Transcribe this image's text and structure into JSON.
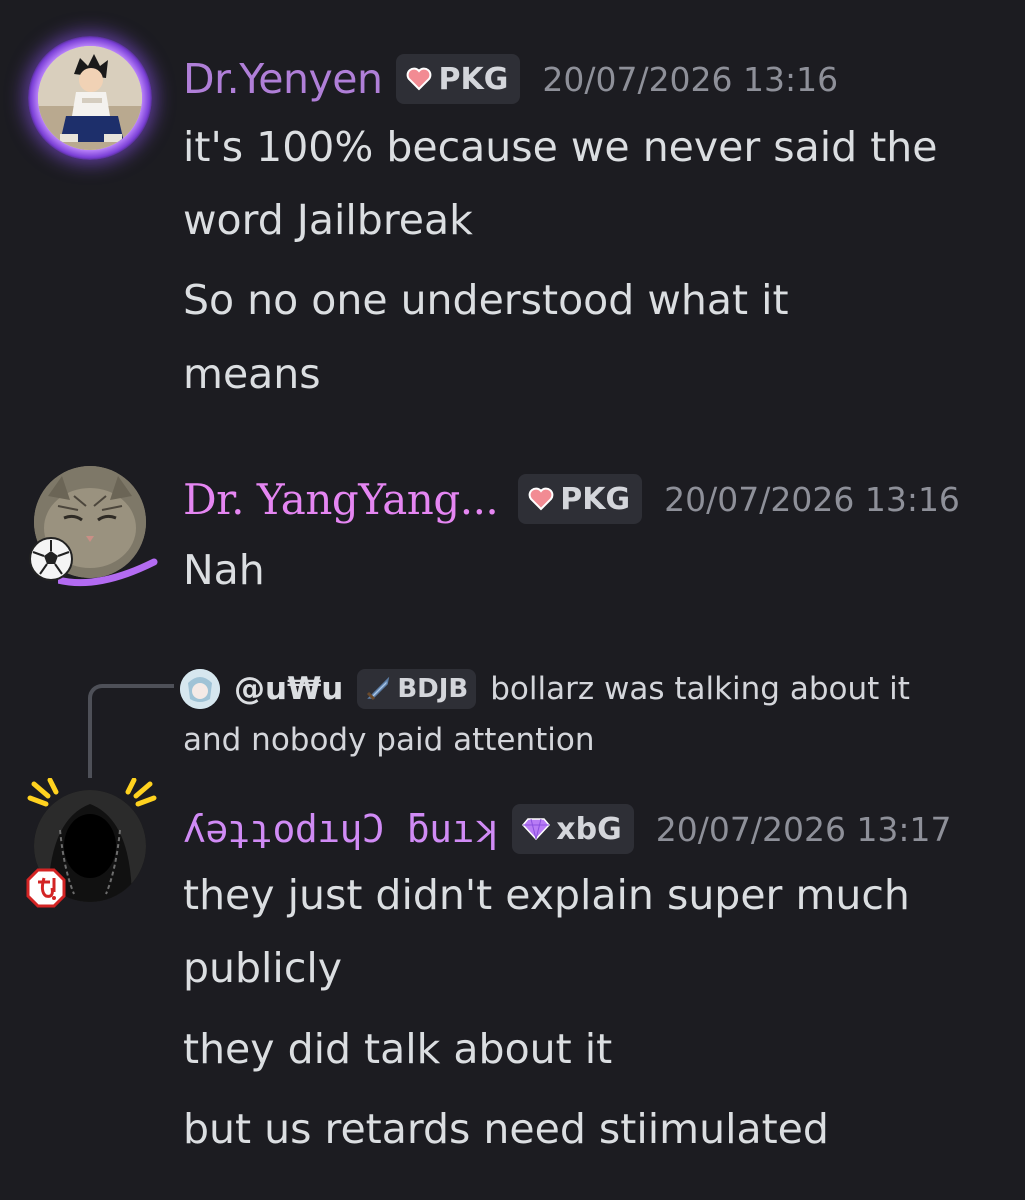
{
  "messages": [
    {
      "username": "Dr.Yenyen",
      "username_color": "#b07fd8",
      "tag": "PKG",
      "tag_icon": "heart-icon",
      "timestamp": "20/07/2026 13:16",
      "lines": [
        "it's 100% because we never said the",
        "word Jailbreak",
        "So no one understood what it",
        "means"
      ]
    },
    {
      "username": "Dr. YangYang...",
      "username_color": "#e586f2",
      "tag": "PKG",
      "tag_icon": "heart-icon",
      "timestamp": "20/07/2026 13:16",
      "lines": [
        "Nah"
      ]
    },
    {
      "reply": {
        "username": "@u₩u",
        "tag": "BDJB",
        "tag_icon": "sword-icon",
        "text_line1": "bollarz was talking about it",
        "text_line2": "and nobody paid attention"
      },
      "username": "ʎǝʇʇodıɥƆ ƃuıʞ",
      "username_color": "#d08bf5",
      "tag": "xbG",
      "tag_icon": "gem-icon",
      "timestamp": "20/07/2026 13:17",
      "lines": [
        "they just didn't explain super much",
        "publicly",
        "they did talk about it",
        "but us retards need stiimulated"
      ]
    }
  ],
  "colors": {
    "background": "#1c1c21",
    "text": "#dbdee1",
    "timestamp": "#8e9099",
    "tag_bg": "#2e2f36"
  }
}
